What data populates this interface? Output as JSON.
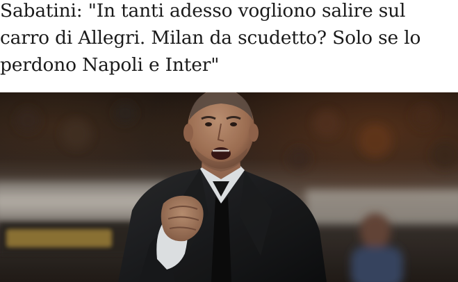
{
  "article": {
    "headline_lines": [
      "Sabatini: \"In tanti adesso vogliono salire sul",
      "carro di Allegri. Milan da scudetto? Solo se lo",
      "perdono Napoli e Inter\""
    ],
    "photo": {
      "subject": "coach-gesturing-photo",
      "colors": {
        "background_dark": "#1e1a17",
        "stand_light": "#cfc9c0",
        "suit": "#161718",
        "shirt": "#eef1f4",
        "skin": "#b98a6c",
        "banner_gold": "#a88a3c"
      }
    }
  }
}
